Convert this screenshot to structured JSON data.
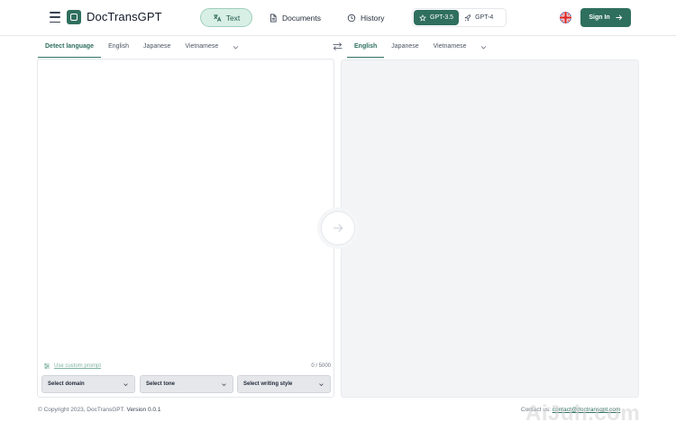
{
  "header": {
    "logo_text": "DocTransGPT",
    "nav": {
      "text": "Text",
      "documents": "Documents",
      "history": "History"
    },
    "models": {
      "gpt35": "GPT-3.5",
      "gpt4": "GPT-4"
    },
    "signin": "Sign In"
  },
  "source_tabs": {
    "detect": "Detect language",
    "english": "English",
    "japanese": "Japanese",
    "vietnamese": "Vietnamese"
  },
  "target_tabs": {
    "english": "English",
    "japanese": "Japanese",
    "vietnamese": "Vietnamese"
  },
  "editor": {
    "custom_prompt": "Use custom prompt",
    "char_count": "0 / 5000",
    "domain": "Select domain",
    "tone": "Select tone",
    "style": "Select writing style"
  },
  "footer": {
    "copyright": "© Copyright 2023, DocTransGPT.",
    "version": "Version 0.0.1",
    "contact_label": "Contact us:",
    "contact_email": "contact@doctransgpt.com"
  },
  "watermark": "AiJuh.com",
  "colors": {
    "accent": "#2f6f5e",
    "accent_light": "#d8efe6",
    "panel_bg": "#f3f4f6"
  }
}
